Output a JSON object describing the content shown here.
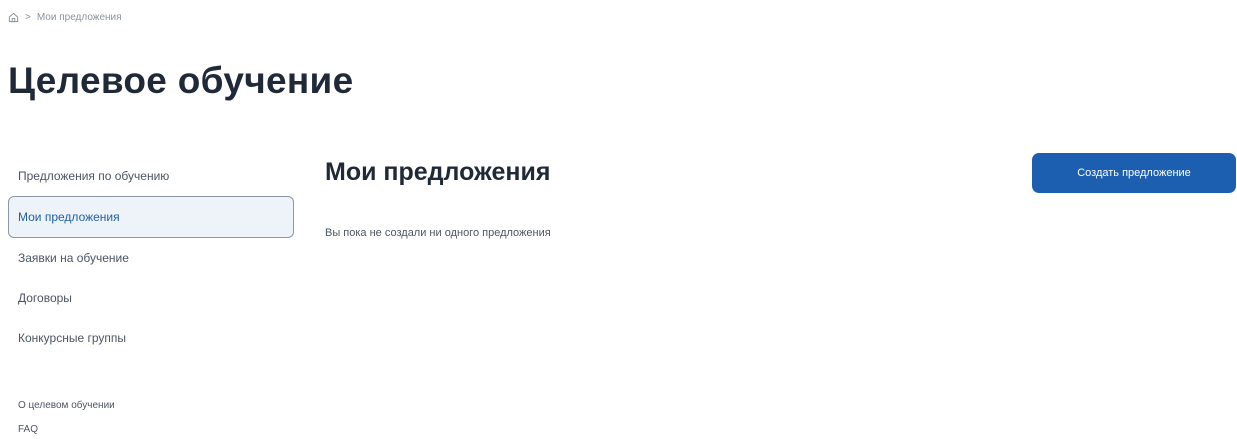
{
  "breadcrumb": {
    "home_icon": "home-icon",
    "separator": ">",
    "current": "Мои предложения"
  },
  "page_title": "Целевое обучение",
  "sidebar": {
    "items": [
      {
        "label": "Предложения по обучению",
        "active": false
      },
      {
        "label": "Мои предложения",
        "active": true
      },
      {
        "label": "Заявки на обучение",
        "active": false
      },
      {
        "label": "Договоры",
        "active": false
      },
      {
        "label": "Конкурсные группы",
        "active": false
      }
    ],
    "links": [
      {
        "label": "О целевом обучении"
      },
      {
        "label": "FAQ"
      }
    ]
  },
  "content": {
    "title": "Мои предложения",
    "empty_message": "Вы пока не создали ни одного предложения",
    "create_button_label": "Создать предложение"
  },
  "colors": {
    "accent": "#1c5fb0",
    "active_bg": "#eef3fa",
    "active_text": "#1f5fa8"
  }
}
